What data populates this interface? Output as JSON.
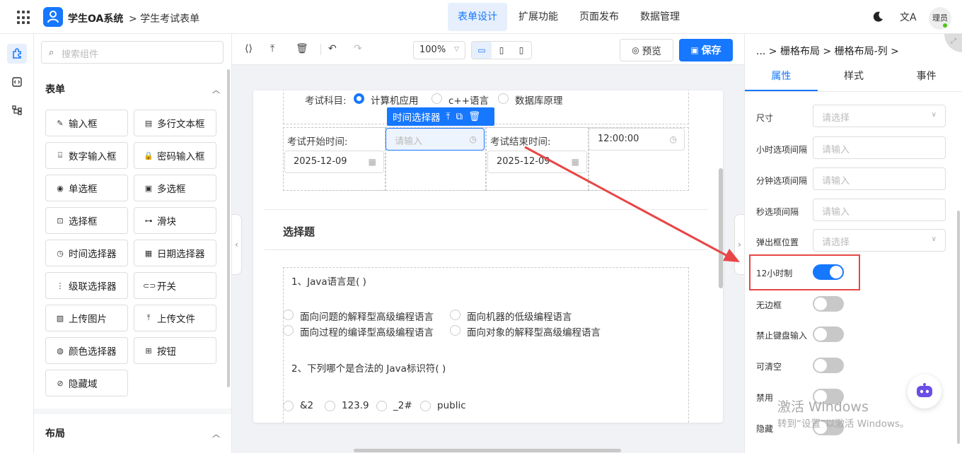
{
  "header": {
    "app_title": "学生OA系统",
    "breadcrumb": "> 学生考试表单",
    "nav": [
      "表单设计",
      "扩展功能",
      "页面发布",
      "数据管理"
    ],
    "translate_label": "文A",
    "avatar_text": "理员"
  },
  "components": {
    "search_placeholder": "搜索组件",
    "form_section": "表单",
    "layout_section": "布局",
    "items": [
      {
        "icon": "✎",
        "label": "输入框"
      },
      {
        "icon": "▤",
        "label": "多行文本框"
      },
      {
        "icon": "⌸",
        "label": "数字输入框"
      },
      {
        "icon": "🔒",
        "label": "密码输入框"
      },
      {
        "icon": "◉",
        "label": "单选框"
      },
      {
        "icon": "▣",
        "label": "多选框"
      },
      {
        "icon": "⊡",
        "label": "选择框"
      },
      {
        "icon": "⊶",
        "label": "滑块"
      },
      {
        "icon": "◷",
        "label": "时间选择器"
      },
      {
        "icon": "▦",
        "label": "日期选择器"
      },
      {
        "icon": "⋮",
        "label": "级联选择器"
      },
      {
        "icon": "⊂⊃",
        "label": "开关"
      },
      {
        "icon": "▨",
        "label": "上传图片"
      },
      {
        "icon": "⤒",
        "label": "上传文件"
      },
      {
        "icon": "◍",
        "label": "颜色选择器"
      },
      {
        "icon": "⊞",
        "label": "按钮"
      },
      {
        "icon": "⊘",
        "label": "隐藏域"
      }
    ]
  },
  "toolbar": {
    "zoom": "100%",
    "preview_label": "预览",
    "save_label": "保存"
  },
  "form": {
    "subject_label": "考试科目:",
    "subject_options": [
      "计算机应用",
      "c++语言",
      "数据库原理"
    ],
    "selected_subject": "计算机应用",
    "selected_widget": "时间选择器",
    "start_time_label": "考试开始时间:",
    "start_date": "2025-12-09",
    "time_placeholder": "请输入",
    "end_time_label": "考试结束时间:",
    "end_date": "2025-12-09",
    "end_time": "12:00:00",
    "choice_group_title": "选择题",
    "q1": "1、Java语言是( )",
    "q1_options": [
      "面向问题的解释型高级编程语言",
      "面向机器的低级编程语言",
      "面向过程的编译型高级编程语言",
      "面向对象的解释型高级编程语言"
    ],
    "q2": "2、下列哪个是合法的 Java标识符( )",
    "q2_options": [
      "&2",
      "123.9",
      "_2#",
      "public"
    ]
  },
  "properties": {
    "breadcrumb": "... > 栅格布局 > 栅格布局-列 >",
    "tabs": [
      "属性",
      "样式",
      "事件"
    ],
    "active_tab": "属性",
    "fields": [
      {
        "label": "尺寸",
        "placeholder": "请选择",
        "kind": "select"
      },
      {
        "label": "小时选项间隔",
        "placeholder": "请输入",
        "kind": "input"
      },
      {
        "label": "分钟选项间隔",
        "placeholder": "请输入",
        "kind": "input"
      },
      {
        "label": "秒选项间隔",
        "placeholder": "请输入",
        "kind": "input"
      },
      {
        "label": "弹出框位置",
        "placeholder": "请选择",
        "kind": "select"
      }
    ],
    "switches": [
      {
        "label": "12小时制",
        "on": true
      },
      {
        "label": "无边框",
        "on": false
      },
      {
        "label": "禁止键盘输入",
        "on": false
      },
      {
        "label": "可清空",
        "on": false
      },
      {
        "label": "禁用",
        "on": false
      },
      {
        "label": "隐藏",
        "on": false
      }
    ]
  },
  "watermark": {
    "line1": "激活 Windows",
    "line2": "转到“设置”以激活 Windows。"
  },
  "colors": {
    "accent": "#1677ff",
    "annotation": "#e84646"
  }
}
